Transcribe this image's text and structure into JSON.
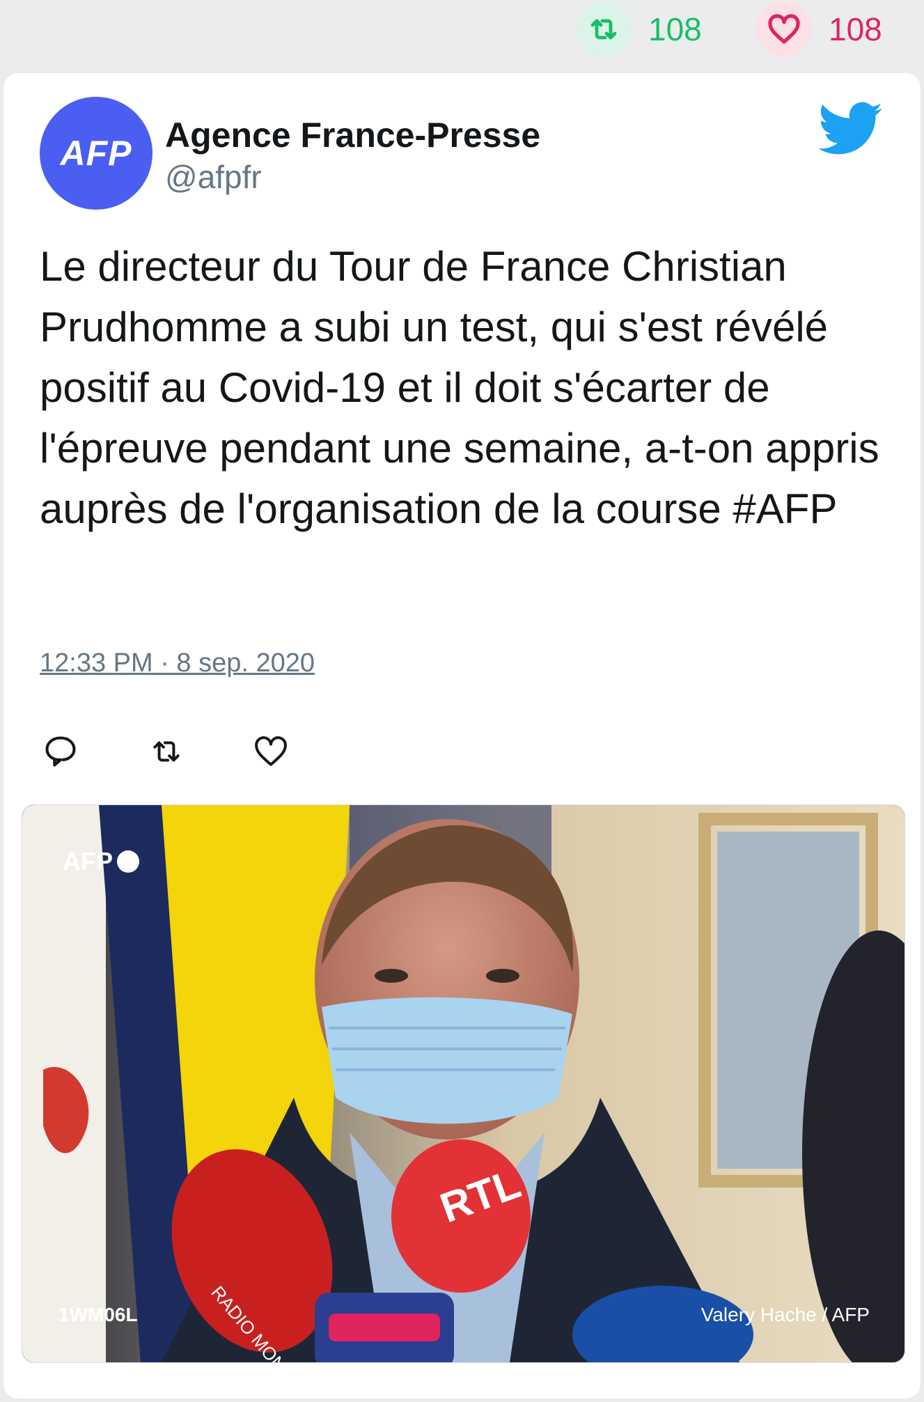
{
  "engagement": {
    "retweets": "108",
    "likes": "108",
    "retweet_color": "#17bf63",
    "like_color": "#e0245e",
    "icons": [
      "retweet-icon",
      "heart-icon"
    ]
  },
  "tweet": {
    "avatar_text": "AFP",
    "avatar_color": "#4a5ef2",
    "display_name": "Agence France-Presse",
    "handle": "@afpfr",
    "brand_icon": "twitter-bird-icon",
    "brand_color": "#1da1f2",
    "text": "Le directeur du Tour de France Christian Prudhomme a subi un test, qui s'est révélé positif au Covid-19 et il doit s'écarter de l'épreuve pendant une semaine, a-t-on appris auprès de l'organisation de la course #AFP",
    "timestamp": "12:33 PM · 8 sep. 2020",
    "actions": [
      "reply-icon",
      "retweet-icon",
      "like-icon"
    ]
  },
  "photo": {
    "watermark": "AFP",
    "code": "1WM06L",
    "credit": "Valery Hache / AFP",
    "mic_labels": [
      "RADIO MONACO",
      "RTL"
    ]
  }
}
